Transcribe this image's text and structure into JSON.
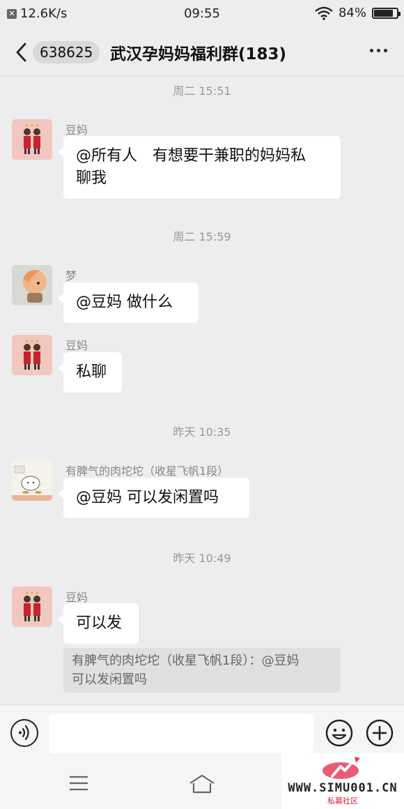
{
  "status_bar": {
    "network_speed": "12.6K/s",
    "time": "09:55",
    "battery": "84%",
    "battery_level": 0.84
  },
  "header": {
    "unread_count": "638625",
    "title": "武汉孕妈妈福利群(183)"
  },
  "timestamps": [
    "周二 15:51",
    "周二 15:59",
    "昨天 10:35",
    "昨天 10:49"
  ],
  "messages": [
    {
      "sender": "豆妈",
      "text_line1": "@所有人　有想要干兼职的妈妈私",
      "text_line2": "聊我"
    },
    {
      "sender": "梦",
      "text": "@豆妈  做什么"
    },
    {
      "sender": "豆妈",
      "text": "私聊"
    },
    {
      "sender": "有脾气的肉坨坨（收星飞帆1段）",
      "text": "@豆妈  可以发闲置吗"
    },
    {
      "sender": "豆妈",
      "text": "可以发"
    }
  ],
  "quote": {
    "line1": "有脾气的肉坨坨（收星飞帆1段）：@豆妈",
    "line2": "可以发闲置吗"
  },
  "icons": {
    "back": "chevron-left-icon",
    "more": "more-dots-icon",
    "voice": "voice-icon",
    "emoji": "emoji-icon",
    "plus": "plus-icon",
    "menu": "menu-icon",
    "home": "home-icon"
  },
  "watermark": {
    "site": "WWW.SIMU001.CN",
    "subtitle": "私募社区"
  },
  "colors": {
    "background": "#ededed",
    "bubble": "#ffffff",
    "quote_bg": "#e0e0e0",
    "watermark_red": "#d8203a"
  }
}
